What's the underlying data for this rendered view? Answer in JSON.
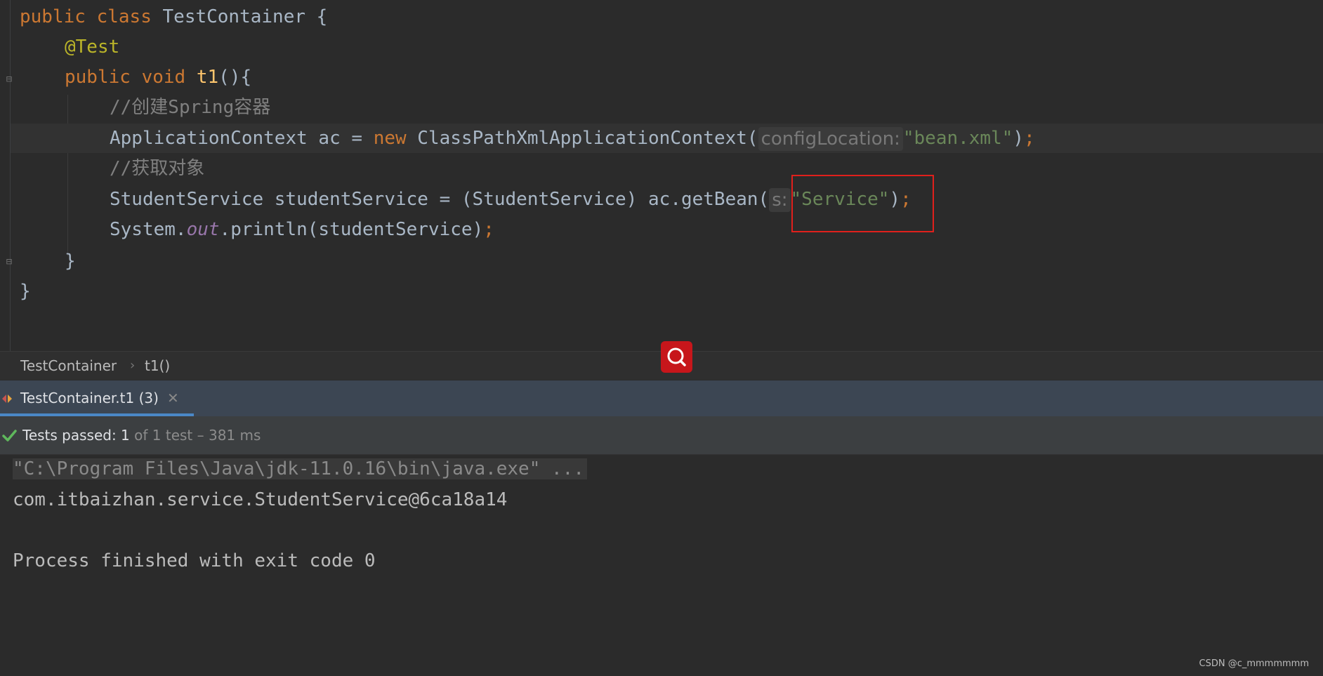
{
  "editor": {
    "lines": {
      "l1": {
        "kw_public": "public",
        "kw_class": "class",
        "class_name": " TestContainer {"
      },
      "l2": {
        "annotation": "@Test"
      },
      "l3": {
        "kw_public": "public",
        "kw_void": "void",
        "method": "t1",
        "rest": "(){"
      },
      "l4": {
        "comment": "//创建Spring容器"
      },
      "l5": {
        "pre": "ApplicationContext ac = ",
        "kw_new": "new",
        "post": " ClassPathXmlApplicationContext(",
        "hint": "configLocation:",
        "str": "\"bean.xml\"",
        "close": ")",
        "semi": ";"
      },
      "l6": {
        "comment": "//获取对象"
      },
      "l7": {
        "pre": "StudentService studentService = (StudentService) ac.getBean(",
        "hint": "s:",
        "str": "\"Service\"",
        "close": ")",
        "semi": ";"
      },
      "l8": {
        "pre": "System.",
        "field": "out",
        "post": ".println(studentService)",
        "semi": ";"
      },
      "l9": {
        "text": "}"
      },
      "l10": {
        "text": "}"
      }
    }
  },
  "breadcrumb": {
    "class_name": "TestContainer",
    "separator": "›",
    "method": "t1()"
  },
  "run": {
    "tab_label": "TestContainer.t1 (3)",
    "tab_close": "✕",
    "status_main": "Tests passed: 1",
    "status_dim": "of 1 test – 381 ms",
    "console": {
      "cmd": "\"C:\\Program Files\\Java\\jdk-11.0.16\\bin\\java.exe\" ...",
      "output": "com.itbaizhan.service.StudentService@6ca18a14",
      "exit": "Process finished with exit code 0"
    }
  },
  "watermark": "CSDN @c_mmmmmmm",
  "colors": {
    "keyword": "#cc7832",
    "annotation": "#bbb529",
    "method": "#ffc66d",
    "comment": "#808080",
    "string": "#6a8759",
    "highlight_box": "#e0201c",
    "tab_accent": "#4a88c7",
    "pass_green": "#5fb85c"
  },
  "icons": [
    "fold-marker-icon",
    "search-fab-icon",
    "run-tab-icon",
    "check-icon",
    "close-icon"
  ]
}
